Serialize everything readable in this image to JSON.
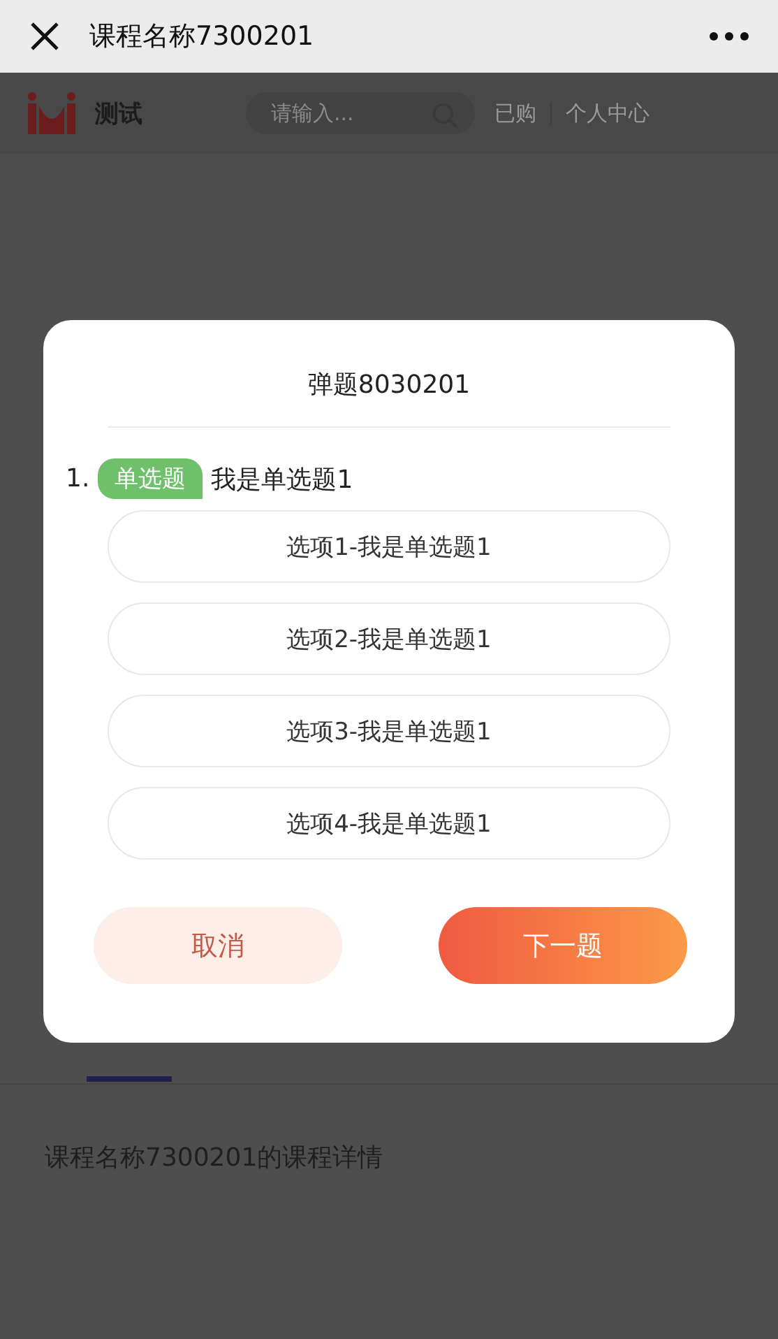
{
  "title_bar": {
    "title": "课程名称7300201"
  },
  "header": {
    "site_name": "测试",
    "search": {
      "placeholder": "请输入..."
    },
    "links": [
      "已购",
      "个人中心"
    ]
  },
  "course_detail": {
    "text": "课程名称7300201的课程详情"
  },
  "dialog": {
    "title": "弹题8030201",
    "question": {
      "number": "1.",
      "type_tag": "单选题",
      "text": "我是单选题1"
    },
    "options": [
      {
        "label": "选项1-我是单选题1",
        "selected": false
      },
      {
        "label": "选项2-我是单选题1",
        "selected": false
      },
      {
        "label": "选项3-我是单选题1",
        "selected": false
      },
      {
        "label": "选项4-我是单选题1",
        "selected": false
      }
    ],
    "buttons": [
      {
        "kind": "cancel",
        "label": "取消"
      },
      {
        "kind": "next",
        "label": "下一题"
      }
    ]
  }
}
